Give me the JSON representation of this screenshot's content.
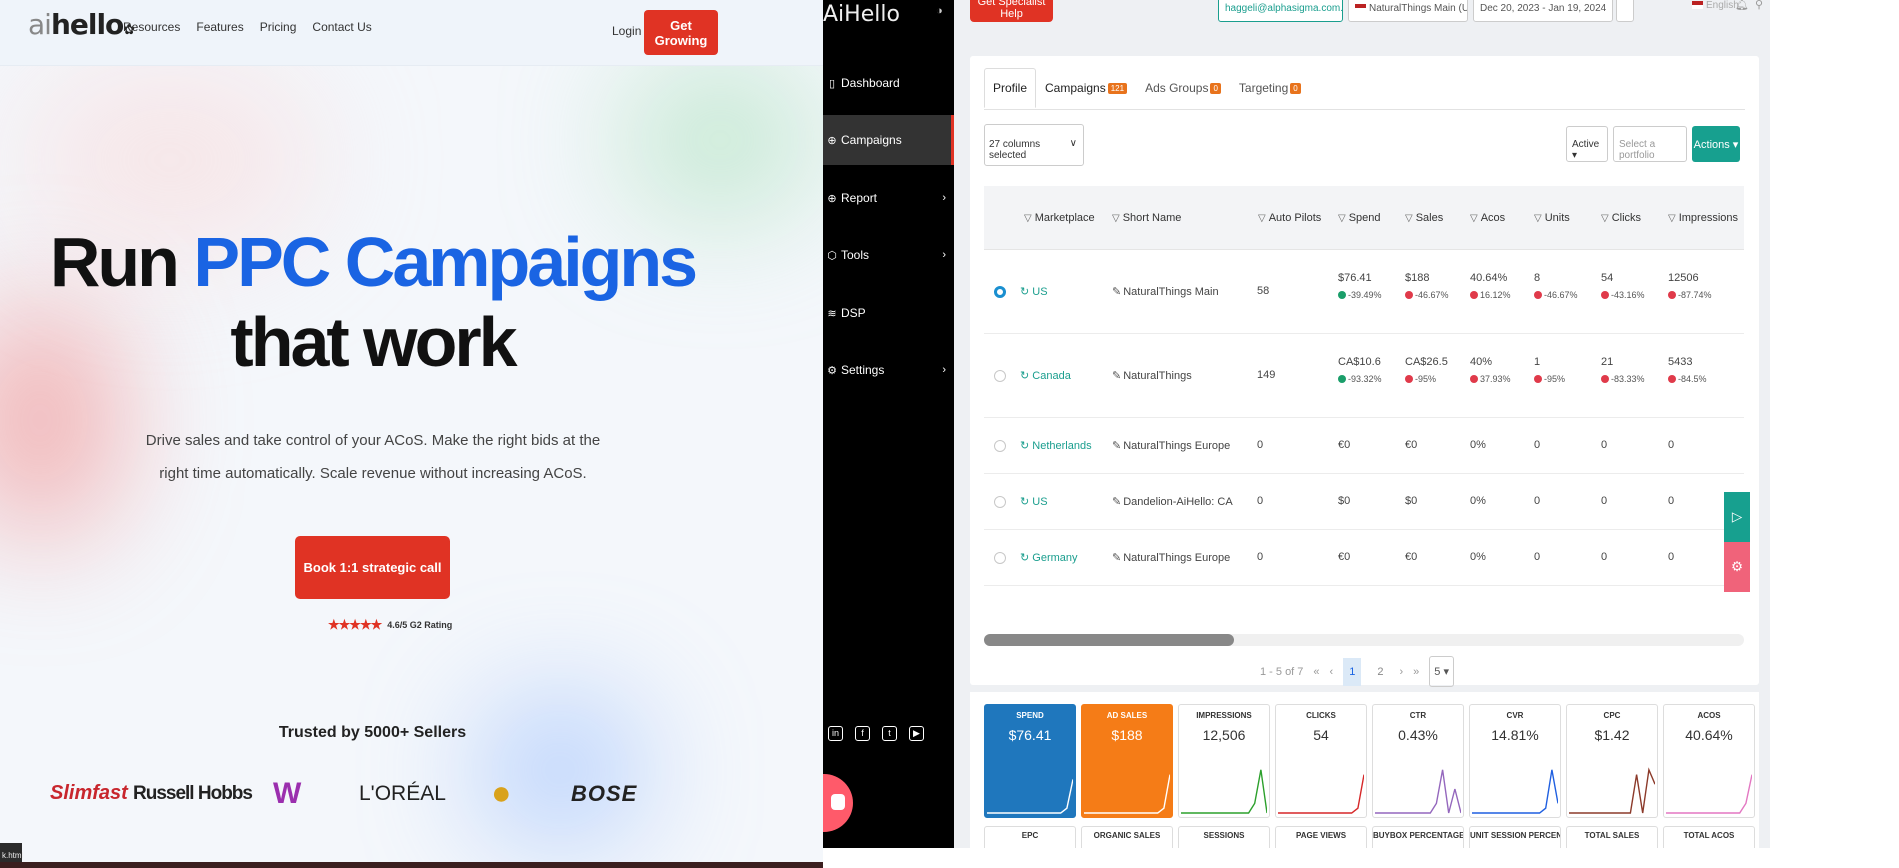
{
  "landing": {
    "logo_ai": "ai",
    "logo_rest": "hello",
    "nav": [
      "Resources",
      "Features",
      "Pricing",
      "Contact Us"
    ],
    "login": "Login",
    "get_growing": "Get Growing",
    "hero_line1_a": "Run ",
    "hero_line1_b": "PPC Campaigns",
    "hero_line2": "that work",
    "subtitle": "Drive sales and take control of your ACoS. Make the right bids at the right time automatically. Scale revenue without increasing ACoS.",
    "cta": "Book 1:1 strategic call",
    "stars": "★★★★★",
    "rating_text": "4.6/5 G2 Rating",
    "trusted": "Trusted by 5000+ Sellers",
    "brands": [
      "Slimfast",
      "Russell Hobbs",
      "W",
      "L'ORÉAL",
      "●",
      "BOSE"
    ],
    "file_tooltip": "k.html"
  },
  "app": {
    "logo": "AiHello",
    "collapse_icon": "◑",
    "sidebar": [
      {
        "label": "Dashboard",
        "icon": "▯",
        "chevron": ""
      },
      {
        "label": "Campaigns",
        "icon": "⊕",
        "chevron": ""
      },
      {
        "label": "Report",
        "icon": "⊕",
        "chevron": "›"
      },
      {
        "label": "Tools",
        "icon": "⬡",
        "chevron": "›"
      },
      {
        "label": "DSP",
        "icon": "≋",
        "chevron": ""
      },
      {
        "label": "Settings",
        "icon": "⚙",
        "chevron": "›"
      }
    ],
    "socials": [
      "in",
      "f",
      "t",
      "▶"
    ],
    "topbar": {
      "specialist": "Get Specialist Help",
      "email": "haggeli@alphasigma.com.au ▾",
      "account": "NaturalThings Main (US) ▾",
      "dates": "Dec 20, 2023 - Jan 19, 2024",
      "lang": "English"
    },
    "tabs": [
      {
        "label": "Profile",
        "count": ""
      },
      {
        "label": "Campaigns",
        "count": "121"
      },
      {
        "label": "Ads Groups",
        "count": "0"
      },
      {
        "label": "Targeting",
        "count": "0"
      }
    ],
    "columns_selected": "27 columns selected",
    "filter_active": "Active ▾",
    "filter_portfolio": "Select a portfolio",
    "actions": "Actions ▾",
    "headers": [
      "Marketplace",
      "Short Name",
      "Auto Pilots",
      "Spend",
      "Sales",
      "Acos",
      "Units",
      "Clicks",
      "Impressions"
    ],
    "rows": [
      {
        "mp": "US",
        "name": "NaturalThings Main",
        "auto": "58",
        "spend": "$76.41",
        "spend_c": "-39.49%",
        "spend_d": "up",
        "sales": "$188",
        "sales_c": "-46.67%",
        "sales_d": "dn",
        "acos": "40.64%",
        "acos_c": "16.12%",
        "acos_d": "dn",
        "units": "8",
        "units_c": "-46.67%",
        "units_d": "dn",
        "clicks": "54",
        "clicks_c": "-43.16%",
        "clicks_d": "dn",
        "impr": "12506",
        "impr_c": "-87.74%",
        "impr_d": "dn"
      },
      {
        "mp": "Canada",
        "name": "NaturalThings",
        "auto": "149",
        "spend": "CA$10.6",
        "spend_c": "-93.32%",
        "spend_d": "up",
        "sales": "CA$26.5",
        "sales_c": "-95%",
        "sales_d": "dn",
        "acos": "40%",
        "acos_c": "37.93%",
        "acos_d": "dn",
        "units": "1",
        "units_c": "-95%",
        "units_d": "dn",
        "clicks": "21",
        "clicks_c": "-83.33%",
        "clicks_d": "dn",
        "impr": "5433",
        "impr_c": "-84.5%",
        "impr_d": "dn"
      },
      {
        "mp": "Netherlands",
        "name": "NaturalThings Europe",
        "auto": "0",
        "spend": "€0",
        "sales": "€0",
        "acos": "0%",
        "units": "0",
        "clicks": "0",
        "impr": "0"
      },
      {
        "mp": "US",
        "name": "Dandelion-AiHello: CA",
        "auto": "0",
        "spend": "$0",
        "sales": "$0",
        "acos": "0%",
        "units": "0",
        "clicks": "0",
        "impr": "0"
      },
      {
        "mp": "Germany",
        "name": "NaturalThings Europe",
        "auto": "0",
        "spend": "€0",
        "sales": "€0",
        "acos": "0%",
        "units": "0",
        "clicks": "0",
        "impr": "0"
      }
    ],
    "pager": {
      "range": "1 - 5 of 7",
      "first": "«",
      "prev": "‹",
      "p1": "1",
      "p2": "2",
      "next": "›",
      "last": "»",
      "per_page": "5 ▾"
    },
    "metric_cards": [
      {
        "label": "SPEND",
        "value": "$76.41",
        "color": "#ffffff"
      },
      {
        "label": "AD SALES",
        "value": "$188",
        "color": "#ffffff"
      },
      {
        "label": "IMPRESSIONS",
        "value": "12,506",
        "color": "#2ca02c"
      },
      {
        "label": "CLICKS",
        "value": "54",
        "color": "#d62728"
      },
      {
        "label": "CTR",
        "value": "0.43%",
        "color": "#9467bd"
      },
      {
        "label": "CVR",
        "value": "14.81%",
        "color": "#1f5fe0"
      },
      {
        "label": "CPC",
        "value": "$1.42",
        "color": "#8c3a2a"
      },
      {
        "label": "ACOS",
        "value": "40.64%",
        "color": "#e377c2"
      }
    ],
    "metric_cards2": [
      "EPC",
      "ORGANIC SALES",
      "SESSIONS",
      "PAGE VIEWS",
      "BUYBOX PERCENTAGE",
      "UNIT SESSION PERCENTAGE",
      "TOTAL SALES",
      "TOTAL ACOS"
    ],
    "colors": {
      "brand_red": "#e03324",
      "teal": "#17a08f",
      "blue": "#1a64e3"
    }
  }
}
